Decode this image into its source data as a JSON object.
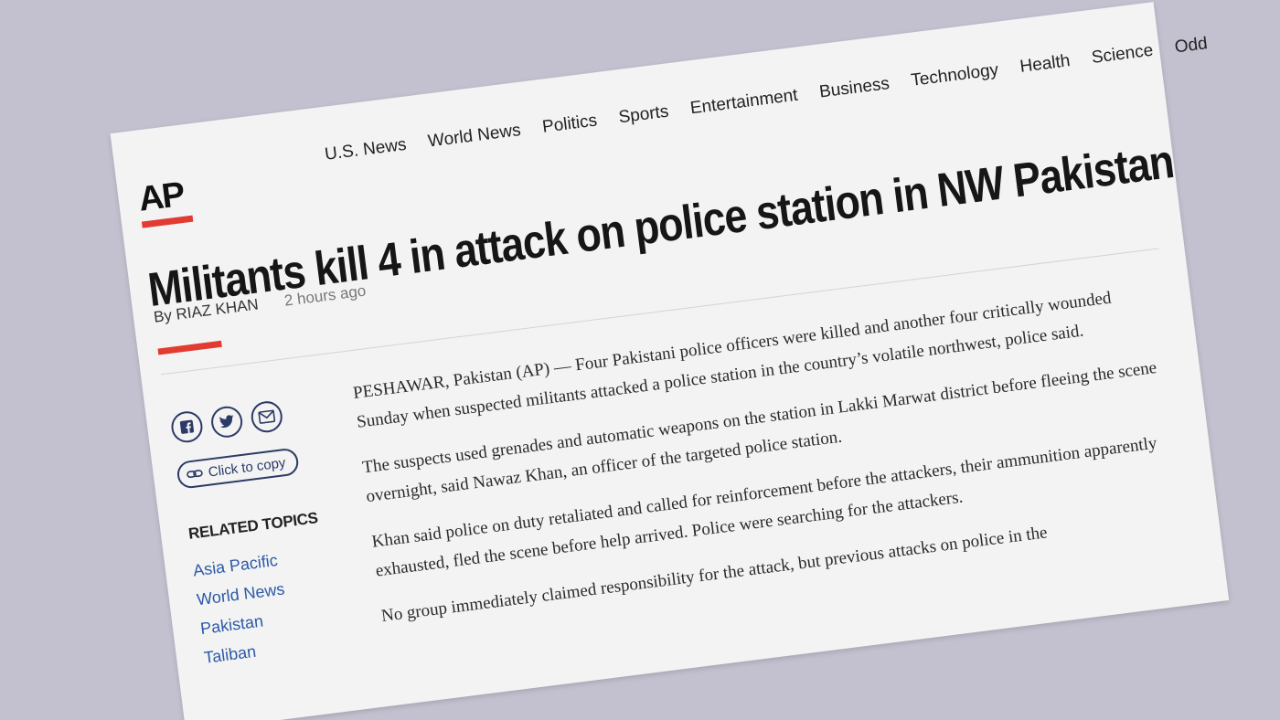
{
  "brand": {
    "logo_text": "AP",
    "accent_color": "#e23b31"
  },
  "nav": {
    "items": [
      "U.S. News",
      "World News",
      "Politics",
      "Sports",
      "Entertainment",
      "Business",
      "Technology",
      "Health",
      "Science",
      "Odd"
    ]
  },
  "article": {
    "headline": "Militants kill 4 in attack on police station in NW Pakistan",
    "byline": "By RIAZ KHAN",
    "time": "2 hours ago",
    "paragraphs": [
      "PESHAWAR, Pakistan (AP) — Four Pakistani police officers were killed and another four critically wounded Sunday when suspected militants attacked a police station in the country’s volatile northwest, police said.",
      "The suspects used grenades and automatic weapons on the station in Lakki Marwat district before fleeing the scene overnight, said Nawaz Khan, an officer of the targeted police station.",
      "Khan said police on duty retaliated and called for reinforcement before the attackers, their ammunition apparently exhausted, fled the scene before help arrived. Police were searching for the attackers.",
      "No group immediately claimed responsibility for the attack, but previous attacks on police in the"
    ]
  },
  "share": {
    "facebook_icon": "facebook-icon",
    "twitter_icon": "twitter-icon",
    "email_icon": "email-icon",
    "copy_label": "Click to copy"
  },
  "related": {
    "title": "RELATED TOPICS",
    "items": [
      "Asia Pacific",
      "World News",
      "Pakistan",
      "Taliban"
    ]
  }
}
